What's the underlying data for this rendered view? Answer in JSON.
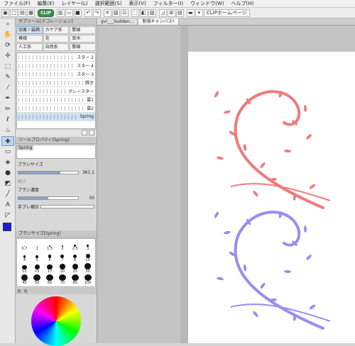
{
  "menu": [
    "ファイル(F)",
    "編集(E)",
    "レイヤー(L)",
    "選択範囲(S)",
    "表示(V)",
    "フィルター(I)",
    "ウィンドウ(W)",
    "ヘルプ(H)"
  ],
  "cmd": {
    "badge": "CLIP",
    "home": "CLIPホームページ"
  },
  "subtool_panel": {
    "title": "サブツール[デコレーション]",
    "tabs": [
      "効果・装飾",
      "カケア系",
      "罫線",
      "模様",
      "花",
      "草木",
      "人工系",
      "自然系",
      "罫線"
    ]
  },
  "brushes": [
    "スター 2",
    "スター 4",
    "スター 3",
    "輝き",
    "グレースター",
    "雲1",
    "雲2",
    "Spring"
  ],
  "toolprop": {
    "title": "ツールプロパティ[Spring]",
    "tag": "Spring",
    "size_label": "ブラシサイズ",
    "size_value": "361.1",
    "size_pct": 0.7,
    "label2": "硬さ",
    "density_label": "ブラシ濃度",
    "density_value": "50",
    "density_pct": 0.5,
    "stab_label": "手ブレ補正"
  },
  "brushsize": {
    "title": "ブラシサイズ[Spring]",
    "sizes": [
      "0.7",
      "1",
      "1.5",
      "2",
      "2.5",
      "3",
      "4",
      "5",
      "6",
      "7",
      "8",
      "10",
      "12",
      "15",
      "17",
      "20",
      "25",
      "30",
      "40",
      "50",
      "60",
      "70",
      "80",
      "100"
    ]
  },
  "colorpanel": {
    "tab1": "カ",
    "tab2": "カ"
  },
  "canvas": {
    "tabs": [
      "gvl___Sudden...",
      "新規キャンバス*"
    ]
  },
  "colors": {
    "pink": "#f07b7b",
    "purple": "#9b8cf0",
    "fg": "#1a1ae6"
  },
  "tool_icons": [
    "zoom-icon",
    "hand-icon",
    "rotate-icon",
    "move-icon",
    "marquee-icon",
    "lasso-icon",
    "eyedropper-icon",
    "pen-icon",
    "pencil-icon",
    "brush-icon",
    "airbrush-icon",
    "decoration-icon",
    "eraser-icon",
    "blend-icon",
    "fill-icon",
    "gradient-icon",
    "figure-icon",
    "text-icon",
    "frame-icon"
  ]
}
